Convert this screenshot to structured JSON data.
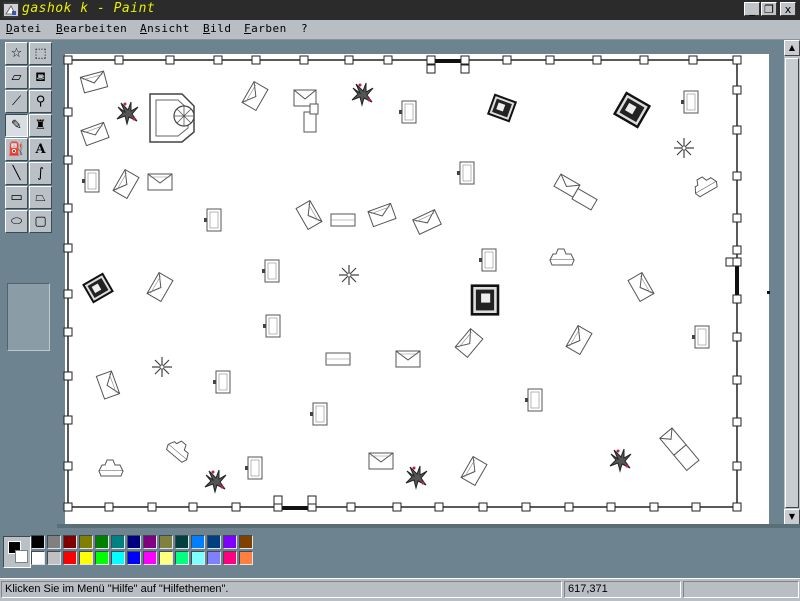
{
  "window": {
    "title": "gashok k - Paint",
    "minimize_glyph": "_",
    "restore_glyph": "❐",
    "close_glyph": "x"
  },
  "menu": {
    "items": [
      "Datei",
      "Bearbeiten",
      "Ansicht",
      "Bild",
      "Farben",
      "?"
    ]
  },
  "toolbox": {
    "tools": [
      {
        "name": "free-form-select-tool",
        "glyph": "☆"
      },
      {
        "name": "select-tool",
        "glyph": "⬚"
      },
      {
        "name": "eraser-tool",
        "glyph": "▱"
      },
      {
        "name": "fill-bucket-tool",
        "glyph": "⛾"
      },
      {
        "name": "color-picker-tool",
        "glyph": "⟋"
      },
      {
        "name": "magnifier-tool",
        "glyph": "⚲"
      },
      {
        "name": "pencil-tool",
        "glyph": "✎"
      },
      {
        "name": "brush-tool",
        "glyph": "♜"
      },
      {
        "name": "airbrush-tool",
        "glyph": "⛽"
      },
      {
        "name": "text-tool",
        "glyph": "A"
      },
      {
        "name": "line-tool",
        "glyph": "╲"
      },
      {
        "name": "curve-tool",
        "glyph": "∫"
      },
      {
        "name": "rectangle-tool",
        "glyph": "▭"
      },
      {
        "name": "polygon-tool",
        "glyph": "⏢"
      },
      {
        "name": "ellipse-tool",
        "glyph": "⬭"
      },
      {
        "name": "rounded-rectangle-tool",
        "glyph": "▢"
      }
    ],
    "active_tool": "pencil-tool"
  },
  "palette": {
    "foreground": "#000000",
    "background": "#ffffff",
    "colors": [
      "#000000",
      "#808080",
      "#800000",
      "#808000",
      "#008000",
      "#008080",
      "#000080",
      "#800080",
      "#808040",
      "#004040",
      "#0080ff",
      "#004080",
      "#8000ff",
      "#804000",
      "#ffffff",
      "#c0c0c0",
      "#ff0000",
      "#ffff00",
      "#00ff00",
      "#00ffff",
      "#0000ff",
      "#ff00ff",
      "#ffff80",
      "#00ff80",
      "#80ffff",
      "#8080ff",
      "#ff0080",
      "#ff8040"
    ]
  },
  "status": {
    "help_text": "Klicken Sie im Menü \"Hilfe\" auf \"Hilfethemen\".",
    "coordinates": "617,371",
    "size": ""
  }
}
